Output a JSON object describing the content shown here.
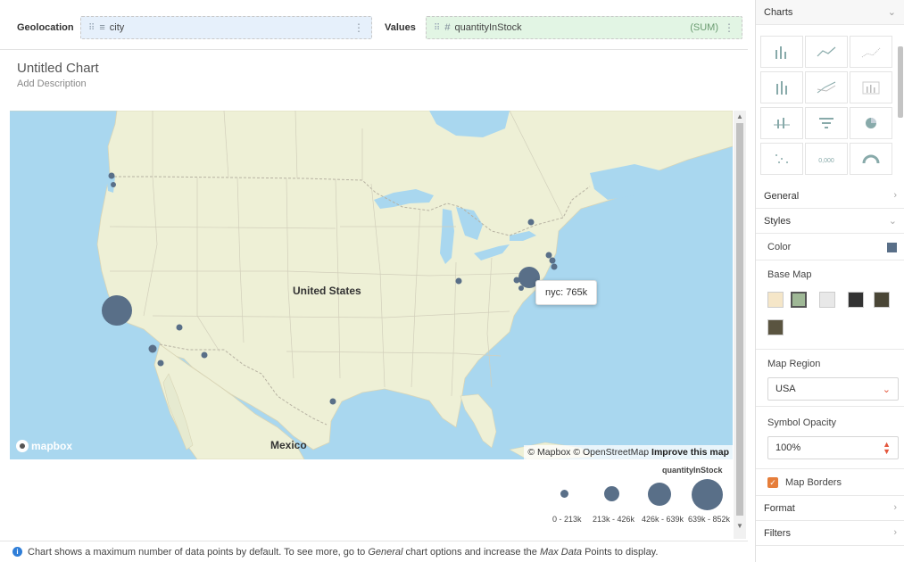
{
  "topbar": {
    "geolocation_label": "Geolocation",
    "geolocation_field": "city",
    "values_label": "Values",
    "values_field": "quantityInStock",
    "values_agg": "(SUM)"
  },
  "chart": {
    "title": "Untitled Chart",
    "description": "Add Description"
  },
  "map": {
    "country_label_us": "United States",
    "country_label_mx": "Mexico",
    "logo_text": "mapbox",
    "attribution": "© Mapbox © OpenStreetMap",
    "attribution_link": "Improve this map",
    "tooltip": "nyc: 765k",
    "colors": {
      "water": "#a9d7ef",
      "land": "#eef0d6",
      "bubble": "#596f88"
    }
  },
  "legend": {
    "title": "quantityInStock",
    "bins": [
      "0 - 213k",
      "213k - 426k",
      "426k - 639k",
      "639k - 852k"
    ]
  },
  "footer": {
    "note_prefix": "Chart shows a maximum number of data points by default. To see more, go to ",
    "note_general": "General",
    "note_mid": " chart options and increase the ",
    "note_max": "Max Data",
    "note_suffix": " Points to display."
  },
  "panel": {
    "charts_header": "Charts",
    "general": "General",
    "styles": "Styles",
    "color_label": "Color",
    "color_value": "#596f88",
    "base_map_label": "Base Map",
    "map_region_label": "Map Region",
    "map_region_value": "USA",
    "symbol_opacity_label": "Symbol Opacity",
    "symbol_opacity_value": "100%",
    "map_borders_label": "Map Borders",
    "format": "Format",
    "filters": "Filters",
    "accent_color": "#e67e3b"
  }
}
